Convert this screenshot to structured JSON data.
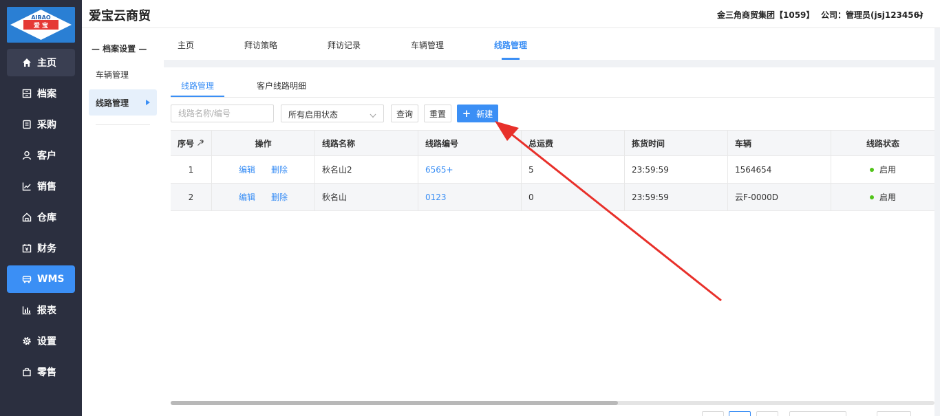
{
  "header": {
    "app_title": "爱宝云商贸",
    "group_name": "金三角商贸集团【1059】",
    "company_user": "公司：管理员(jsj123456)"
  },
  "logo": {
    "brand_en": "AIBAO",
    "brand_cn": "爱 宝"
  },
  "sidebar": {
    "items": [
      {
        "label": "主页",
        "icon": "home-icon"
      },
      {
        "label": "档案",
        "icon": "archive-icon"
      },
      {
        "label": "采购",
        "icon": "purchase-icon"
      },
      {
        "label": "客户",
        "icon": "user-icon"
      },
      {
        "label": "销售",
        "icon": "sales-chart-icon"
      },
      {
        "label": "仓库",
        "icon": "warehouse-icon"
      },
      {
        "label": "财务",
        "icon": "finance-icon"
      },
      {
        "label": "WMS",
        "icon": "truck-icon"
      },
      {
        "label": "报表",
        "icon": "report-icon"
      },
      {
        "label": "设置",
        "icon": "gear-icon"
      },
      {
        "label": "零售",
        "icon": "bag-icon"
      }
    ]
  },
  "subsidebar": {
    "title": "— 档案设置 —",
    "items": [
      {
        "label": "车辆管理"
      },
      {
        "label": "线路管理"
      }
    ]
  },
  "top_tabs": [
    "主页",
    "拜访策略",
    "拜访记录",
    "车辆管理",
    "线路管理"
  ],
  "sub_tabs": [
    "线路管理",
    "客户线路明细"
  ],
  "filters": {
    "search_placeholder": "线路名称/编号",
    "status_value": "所有启用状态",
    "query_label": "查询",
    "reset_label": "重置",
    "new_label": "新建"
  },
  "table": {
    "headers": [
      "序号",
      "操作",
      "线路名称",
      "线路编号",
      "总运费",
      "拣货时间",
      "车辆",
      "线路状态"
    ],
    "actions": {
      "edit": "编辑",
      "delete": "删除"
    },
    "rows": [
      {
        "index": "1",
        "name": "秋名山2",
        "code": "6565+",
        "freight": "5",
        "pick_time": "23:59:59",
        "vehicle": "1564654",
        "status": "启用"
      },
      {
        "index": "2",
        "name": "秋名山",
        "code": "0123",
        "freight": "0",
        "pick_time": "23:59:59",
        "vehicle": "云F-0000D",
        "status": "启用"
      }
    ]
  },
  "colors": {
    "accent": "#3b8ff5",
    "sidebar_bg": "#2b2f3f",
    "status_green": "#52c41a",
    "arrow_red": "#e8302a"
  }
}
